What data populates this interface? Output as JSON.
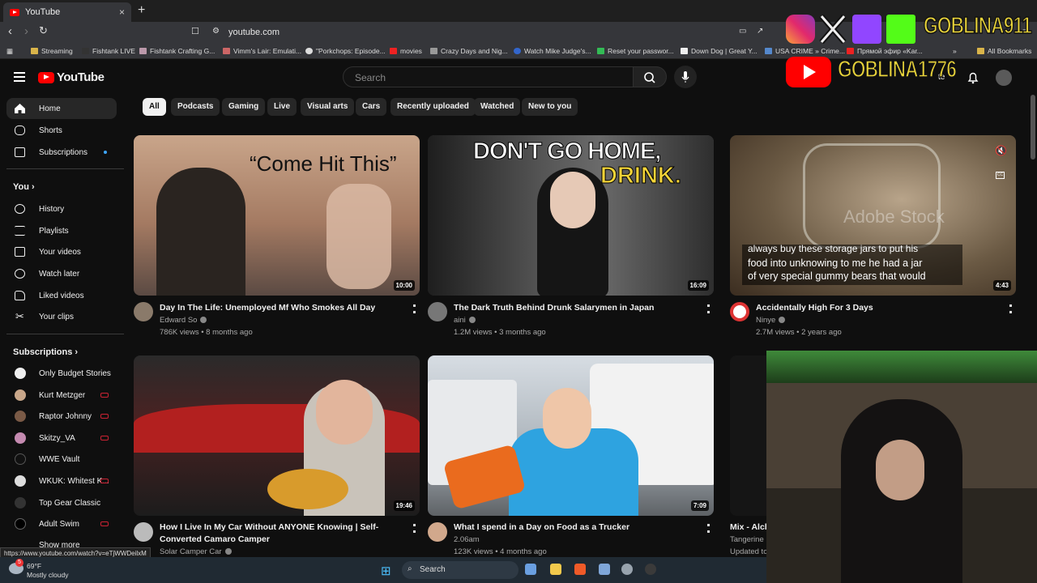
{
  "browser": {
    "tab_title": "YouTube",
    "new_tab": "+",
    "close": "×",
    "url": "youtube.com",
    "bookmarks": [
      "Streaming",
      "Fishtank LIVE",
      "Fishtank Crafting G...",
      "Vimm's Lair: Emulati...",
      "\"Porkchops: Episode...",
      "movies",
      "Crazy Days and Nig...",
      "Watch Mike Judge's...",
      "Reset your passwor...",
      "Down Dog | Great Y...",
      "USA CRIME » Crime...",
      "Прямой эфир «Kar..."
    ],
    "bookmarks_more": "»",
    "all_bookmarks": "All Bookmarks"
  },
  "header": {
    "logo_text": "YouTube",
    "search_placeholder": "Search",
    "create_partial": "te"
  },
  "chips": [
    "All",
    "Podcasts",
    "Gaming",
    "Live",
    "Visual arts",
    "Cars",
    "Recently uploaded",
    "Watched",
    "New to you"
  ],
  "sidebar": {
    "main": [
      "Home",
      "Shorts",
      "Subscriptions"
    ],
    "you_heading": "You",
    "you_items": [
      "History",
      "Playlists",
      "Your videos",
      "Watch later",
      "Liked videos",
      "Your clips"
    ],
    "subs_heading": "Subscriptions",
    "subs": [
      "Only Budget Stories",
      "Kurt Metzger",
      "Raptor Johnny",
      "Skitzy_VA",
      "WWE Vault",
      "WKUK: Whitest K...",
      "Top Gear Classic",
      "Adult Swim"
    ],
    "show_more": "Show more"
  },
  "videos": [
    {
      "title": "Day In The Life: Unemployed Mf Who Smokes All Day",
      "channel": "Edward So",
      "meta": "786K views • 8 months ago",
      "duration": "10:00",
      "thumb_text": "“Come Hit This”"
    },
    {
      "title": "The Dark Truth Behind Drunk Salarymen in Japan",
      "channel": "aini",
      "meta": "1.2M views • 3 months ago",
      "duration": "16:09",
      "thumb_text1": "DON'T GO HOME,",
      "thumb_text2": "DRINK."
    },
    {
      "title": "Accidentally High For 3 Days",
      "channel": "Ninye",
      "meta": "2.7M views • 2 years ago",
      "duration": "4:43",
      "caption1": "food into unknowing to me he had a jar",
      "caption2": "of very special gummy bears that would",
      "caption0": "always buy these storage jars to put his",
      "watermark": "Adobe Stock"
    },
    {
      "title": "How I Live In My Car Without ANYONE Knowing | Self-Converted Camaro Camper",
      "channel": "Solar Camper Car",
      "meta": "",
      "duration": "19:46"
    },
    {
      "title": "What I spend in a Day on Food as a Trucker",
      "channel": "2.06am",
      "meta": "123K views • 4 months ago",
      "duration": "7:09"
    },
    {
      "title": "Mix - Alcl",
      "channel": "Tangerine",
      "meta": "Updated to"
    }
  ],
  "status_url": "https://www.youtube.com/watch?v=eTjWWDeilxM",
  "taskbar": {
    "temp": "69°F",
    "weather": "Mostly cloudy",
    "search": "Search",
    "badge": "5"
  },
  "overlay": {
    "handle1": "GOBLINA911",
    "handle2": "GOBLINA1776"
  },
  "colors": {
    "bg": "#0f0f0f",
    "yt_red": "#ff0000",
    "chip": "#272727",
    "overlay_text": "#e8d33a"
  }
}
